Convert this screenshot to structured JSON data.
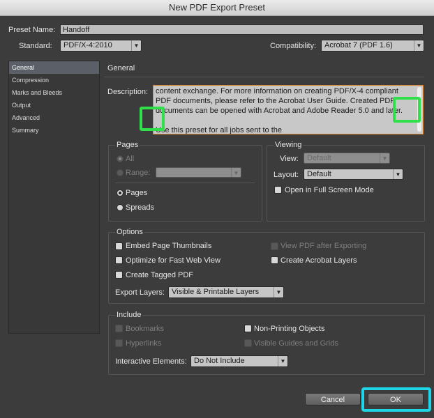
{
  "window": {
    "title": "New PDF Export Preset"
  },
  "preset": {
    "name_label": "Preset Name:",
    "name_value": "Handoff"
  },
  "standard": {
    "label": "Standard:",
    "value": "PDF/X-4:2010"
  },
  "compatibility": {
    "label": "Compatibility:",
    "value": "Acrobat 7 (PDF 1.6)"
  },
  "sidebar": {
    "items": [
      {
        "label": "General",
        "active": true
      },
      {
        "label": "Compression"
      },
      {
        "label": "Marks and Bleeds"
      },
      {
        "label": "Output"
      },
      {
        "label": "Advanced"
      },
      {
        "label": "Summary"
      }
    ]
  },
  "general": {
    "heading": "General",
    "description_label": "Description:",
    "description_lines": [
      "content exchange.  For more information on creating PDF/X-4 compliant",
      "PDF documents, please refer to the Acrobat User Guide.  Created PDF",
      "documents can be opened with Acrobat and Adobe Reader 5.0 and later.",
      "",
      "Use this preset for all jobs sent to the"
    ]
  },
  "pages": {
    "title": "Pages",
    "all_label": "All",
    "range_label": "Range:",
    "pages_label": "Pages",
    "spreads_label": "Spreads"
  },
  "viewing": {
    "title": "Viewing",
    "view_label": "View:",
    "view_value": "Default",
    "layout_label": "Layout:",
    "layout_value": "Default",
    "fullscreen_label": "Open in Full Screen Mode"
  },
  "options": {
    "title": "Options",
    "embed_thumbnails": "Embed Page Thumbnails",
    "optimize_web": "Optimize for Fast Web View",
    "create_tagged": "Create Tagged PDF",
    "view_after": "View PDF after Exporting",
    "acrobat_layers": "Create Acrobat Layers",
    "export_layers_label": "Export Layers:",
    "export_layers_value": "Visible & Printable Layers"
  },
  "include": {
    "title": "Include",
    "bookmarks": "Bookmarks",
    "hyperlinks": "Hyperlinks",
    "non_printing": "Non-Printing Objects",
    "visible_guides": "Visible Guides and Grids",
    "interactive_label": "Interactive Elements:",
    "interactive_value": "Do Not Include"
  },
  "buttons": {
    "cancel": "Cancel",
    "ok": "OK"
  },
  "colors": {
    "highlight_green": "#2fe04a",
    "highlight_cyan": "#1fd6e6",
    "desc_border": "#d7842c"
  }
}
